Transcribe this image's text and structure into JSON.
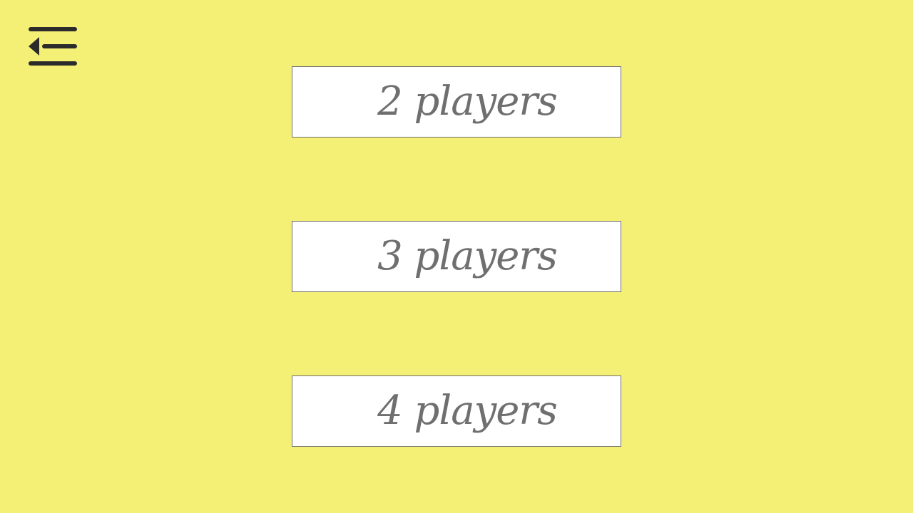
{
  "menu": {
    "icon": "menu-collapse-icon",
    "icon_color": "#2b2b2b"
  },
  "player_options": [
    {
      "label": "2 players"
    },
    {
      "label": "3 players"
    },
    {
      "label": "4 players"
    }
  ],
  "colors": {
    "background": "#f4f075",
    "button_background": "#ffffff",
    "button_border": "#6f6f6f",
    "button_text": "#6f6f6f"
  }
}
